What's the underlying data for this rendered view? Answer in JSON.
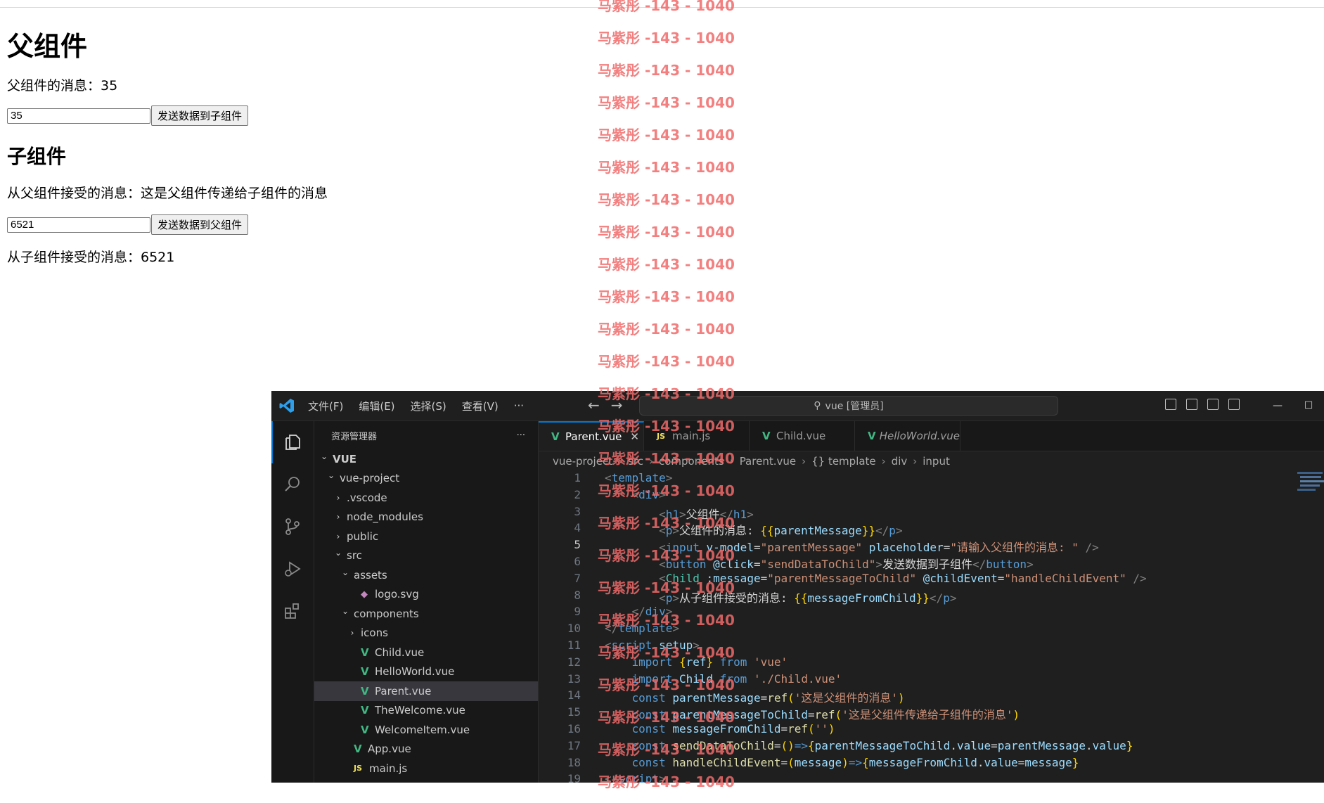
{
  "browser": {
    "parent_heading": "父组件",
    "parent_message": "父组件的消息：35",
    "parent_input_value": "35",
    "parent_button": "发送数据到子组件",
    "child_heading": "子组件",
    "child_received": "从父组件接受的消息：这是父组件传递给子组件的消息",
    "child_input_value": "6521",
    "child_button": "发送数据到父组件",
    "from_child": "从子组件接受的消息：6521"
  },
  "watermark": {
    "text": "马紫彤 -143 - 1040"
  },
  "vscode": {
    "menu": [
      "文件(F)",
      "编辑(E)",
      "选择(S)",
      "查看(V)",
      "···"
    ],
    "search": "vue [管理员]",
    "explorer_title": "资源管理器",
    "explorer_more": "···",
    "tree": [
      {
        "label": "VUE",
        "depth": 0,
        "chev": "⌄",
        "type": "root"
      },
      {
        "label": "vue-project",
        "depth": 1,
        "chev": "⌄",
        "type": "folder"
      },
      {
        "label": ".vscode",
        "depth": 2,
        "chev": "›",
        "type": "folder"
      },
      {
        "label": "node_modules",
        "depth": 2,
        "chev": "›",
        "type": "folder"
      },
      {
        "label": "public",
        "depth": 2,
        "chev": "›",
        "type": "folder"
      },
      {
        "label": "src",
        "depth": 2,
        "chev": "⌄",
        "type": "folder"
      },
      {
        "label": "assets",
        "depth": 3,
        "chev": "⌄",
        "type": "folder"
      },
      {
        "label": "logo.svg",
        "depth": 4,
        "chev": "",
        "type": "svg"
      },
      {
        "label": "components",
        "depth": 3,
        "chev": "⌄",
        "type": "folder"
      },
      {
        "label": "icons",
        "depth": 4,
        "chev": "›",
        "type": "folder"
      },
      {
        "label": "Child.vue",
        "depth": 4,
        "chev": "",
        "type": "vue"
      },
      {
        "label": "HelloWorld.vue",
        "depth": 4,
        "chev": "",
        "type": "vue"
      },
      {
        "label": "Parent.vue",
        "depth": 4,
        "chev": "",
        "type": "vue",
        "selected": true
      },
      {
        "label": "TheWelcome.vue",
        "depth": 4,
        "chev": "",
        "type": "vue"
      },
      {
        "label": "WelcomeItem.vue",
        "depth": 4,
        "chev": "",
        "type": "vue"
      },
      {
        "label": "App.vue",
        "depth": 3,
        "chev": "",
        "type": "vue"
      },
      {
        "label": "main.js",
        "depth": 3,
        "chev": "",
        "type": "js"
      }
    ],
    "tabs": [
      {
        "label": "Parent.vue",
        "icon": "vue",
        "active": true,
        "close": "✕"
      },
      {
        "label": "main.js",
        "icon": "js"
      },
      {
        "label": "Child.vue",
        "icon": "vue"
      },
      {
        "label": "HelloWorld.vue",
        "icon": "vue",
        "italic": true
      }
    ],
    "breadcrumb": [
      "vue-project",
      "src",
      "components",
      "Parent.vue",
      "{} template",
      "div",
      "input"
    ],
    "code": [
      {
        "n": "1",
        "tokens": [
          [
            "tg",
            "<"
          ],
          [
            "tn",
            "template"
          ],
          [
            "tg",
            ">"
          ]
        ]
      },
      {
        "n": "2",
        "tokens": [
          [
            "src",
            "    "
          ],
          [
            "tg",
            "<"
          ],
          [
            "tn",
            "div"
          ],
          [
            "tg",
            ">"
          ]
        ]
      },
      {
        "n": "3",
        "tokens": [
          [
            "src",
            "        "
          ],
          [
            "tg",
            "<"
          ],
          [
            "tn",
            "h1"
          ],
          [
            "tg",
            ">"
          ],
          [
            "src",
            "父组件"
          ],
          [
            "tg",
            "</"
          ],
          [
            "tn",
            "h1"
          ],
          [
            "tg",
            ">"
          ]
        ]
      },
      {
        "n": "4",
        "tokens": [
          [
            "src",
            "        "
          ],
          [
            "tg",
            "<"
          ],
          [
            "tn",
            "p"
          ],
          [
            "tg",
            ">"
          ],
          [
            "src",
            "父组件的消息: "
          ],
          [
            "br",
            "{{"
          ],
          [
            "vr",
            "parentMessage"
          ],
          [
            "br",
            "}}"
          ],
          [
            "tg",
            "</"
          ],
          [
            "tn",
            "p"
          ],
          [
            "tg",
            ">"
          ]
        ]
      },
      {
        "n": "5",
        "tokens": [
          [
            "src",
            "        "
          ],
          [
            "tg",
            "<"
          ],
          [
            "tn",
            "input"
          ],
          [
            "src",
            " "
          ],
          [
            "at",
            "v-model"
          ],
          [
            "src",
            "="
          ],
          [
            "st",
            "\"parentMessage\""
          ],
          [
            "src",
            " "
          ],
          [
            "at",
            "placeholder"
          ],
          [
            "src",
            "="
          ],
          [
            "st",
            "\"请输入父组件的消息: \""
          ],
          [
            "src",
            " "
          ],
          [
            "tg",
            "/>"
          ]
        ],
        "current": true
      },
      {
        "n": "6",
        "tokens": [
          [
            "src",
            "        "
          ],
          [
            "tg",
            "<"
          ],
          [
            "tn",
            "button"
          ],
          [
            "src",
            " "
          ],
          [
            "at",
            "@click"
          ],
          [
            "src",
            "="
          ],
          [
            "st",
            "\"sendDataToChild\""
          ],
          [
            "tg",
            ">"
          ],
          [
            "src",
            "发送数据到子组件"
          ],
          [
            "tg",
            "</"
          ],
          [
            "tn",
            "button"
          ],
          [
            "tg",
            ">"
          ]
        ]
      },
      {
        "n": "7",
        "tokens": [
          [
            "src",
            "        "
          ],
          [
            "tg",
            "<"
          ],
          [
            "cp",
            "Child"
          ],
          [
            "src",
            " "
          ],
          [
            "at",
            ":message"
          ],
          [
            "src",
            "="
          ],
          [
            "st",
            "\"parentMessageToChild\""
          ],
          [
            "src",
            " "
          ],
          [
            "at",
            "@childEvent"
          ],
          [
            "src",
            "="
          ],
          [
            "st",
            "\"handleChildEvent\""
          ],
          [
            "src",
            " "
          ],
          [
            "tg",
            "/>"
          ]
        ]
      },
      {
        "n": "8",
        "tokens": [
          [
            "src",
            "        "
          ],
          [
            "tg",
            "<"
          ],
          [
            "tn",
            "p"
          ],
          [
            "tg",
            ">"
          ],
          [
            "src",
            "从子组件接受的消息: "
          ],
          [
            "br",
            "{{"
          ],
          [
            "vr",
            "messageFromChild"
          ],
          [
            "br",
            "}}"
          ],
          [
            "tg",
            "</"
          ],
          [
            "tn",
            "p"
          ],
          [
            "tg",
            ">"
          ]
        ]
      },
      {
        "n": "9",
        "tokens": [
          [
            "src",
            "    "
          ],
          [
            "tg",
            "</"
          ],
          [
            "tn",
            "div"
          ],
          [
            "tg",
            ">"
          ]
        ]
      },
      {
        "n": "10",
        "tokens": [
          [
            "tg",
            "</"
          ],
          [
            "tn",
            "template"
          ],
          [
            "tg",
            ">"
          ]
        ]
      },
      {
        "n": "11",
        "tokens": [
          [
            "tg",
            "<"
          ],
          [
            "tn",
            "script"
          ],
          [
            "src",
            " "
          ],
          [
            "at",
            "setup"
          ],
          [
            "tg",
            ">"
          ]
        ]
      },
      {
        "n": "12",
        "tokens": [
          [
            "src",
            "    "
          ],
          [
            "kw",
            "import"
          ],
          [
            "src",
            " "
          ],
          [
            "br",
            "{"
          ],
          [
            "vr",
            "ref"
          ],
          [
            "br",
            "}"
          ],
          [
            "src",
            " "
          ],
          [
            "kw",
            "from"
          ],
          [
            "src",
            " "
          ],
          [
            "st",
            "'vue'"
          ]
        ]
      },
      {
        "n": "13",
        "tokens": [
          [
            "src",
            "    "
          ],
          [
            "kw",
            "import"
          ],
          [
            "src",
            " "
          ],
          [
            "vr",
            "Child"
          ],
          [
            "src",
            " "
          ],
          [
            "kw",
            "from"
          ],
          [
            "src",
            " "
          ],
          [
            "st",
            "'./Child.vue'"
          ]
        ]
      },
      {
        "n": "14",
        "tokens": [
          [
            "src",
            "    "
          ],
          [
            "kw",
            "const"
          ],
          [
            "src",
            " "
          ],
          [
            "vr",
            "parentMessage"
          ],
          [
            "src",
            "="
          ],
          [
            "fn",
            "ref"
          ],
          [
            "br",
            "("
          ],
          [
            "st",
            "'这是父组件的消息'"
          ],
          [
            "br",
            ")"
          ]
        ]
      },
      {
        "n": "15",
        "tokens": [
          [
            "src",
            "    "
          ],
          [
            "kw",
            "const"
          ],
          [
            "src",
            " "
          ],
          [
            "vr",
            "parentMessageToChild"
          ],
          [
            "src",
            "="
          ],
          [
            "fn",
            "ref"
          ],
          [
            "br",
            "("
          ],
          [
            "st",
            "'这是父组件传递给子组件的消息'"
          ],
          [
            "br",
            ")"
          ]
        ]
      },
      {
        "n": "16",
        "tokens": [
          [
            "src",
            "    "
          ],
          [
            "kw",
            "const"
          ],
          [
            "src",
            " "
          ],
          [
            "vr",
            "messageFromChild"
          ],
          [
            "src",
            "="
          ],
          [
            "fn",
            "ref"
          ],
          [
            "br",
            "("
          ],
          [
            "st",
            "''"
          ],
          [
            "br",
            ")"
          ]
        ]
      },
      {
        "n": "17",
        "tokens": [
          [
            "src",
            "    "
          ],
          [
            "kw",
            "const"
          ],
          [
            "src",
            " "
          ],
          [
            "fn",
            "sendDataToChild"
          ],
          [
            "src",
            "="
          ],
          [
            "br",
            "()"
          ],
          [
            "kw",
            "=>"
          ],
          [
            "br",
            "{"
          ],
          [
            "vr",
            "parentMessageToChild"
          ],
          [
            "src",
            "."
          ],
          [
            "vr",
            "value"
          ],
          [
            "src",
            "="
          ],
          [
            "vr",
            "parentMessage"
          ],
          [
            "src",
            "."
          ],
          [
            "vr",
            "value"
          ],
          [
            "br",
            "}"
          ]
        ]
      },
      {
        "n": "18",
        "tokens": [
          [
            "src",
            "    "
          ],
          [
            "kw",
            "const"
          ],
          [
            "src",
            " "
          ],
          [
            "fn",
            "handleChildEvent"
          ],
          [
            "src",
            "="
          ],
          [
            "br",
            "("
          ],
          [
            "vr",
            "message"
          ],
          [
            "br",
            ")"
          ],
          [
            "kw",
            "=>"
          ],
          [
            "br",
            "{"
          ],
          [
            "vr",
            "messageFromChild"
          ],
          [
            "src",
            "."
          ],
          [
            "vr",
            "value"
          ],
          [
            "src",
            "="
          ],
          [
            "vr",
            "message"
          ],
          [
            "br",
            "}"
          ]
        ]
      },
      {
        "n": "19",
        "tokens": [
          [
            "tg",
            "</"
          ],
          [
            "tn",
            "script"
          ],
          [
            "tg",
            ">"
          ]
        ]
      }
    ]
  }
}
